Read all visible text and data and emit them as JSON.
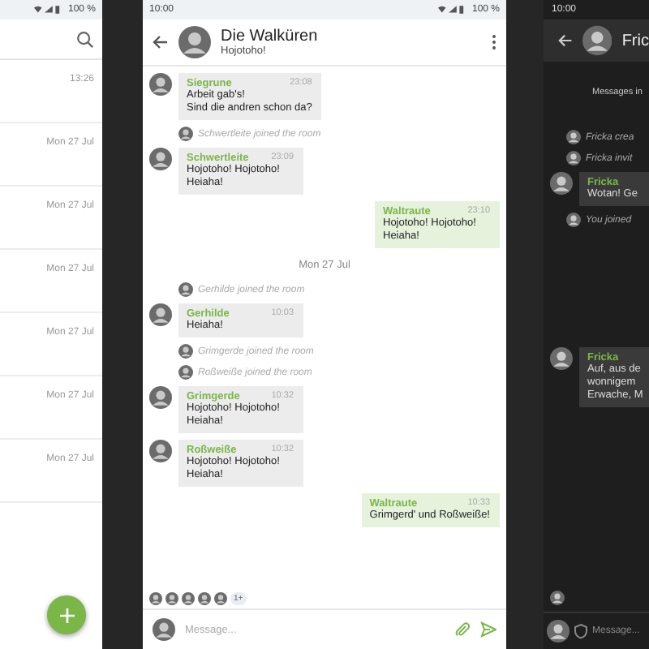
{
  "list_screen": {
    "status_battery": "100 %",
    "rows": [
      {
        "time": "13:26"
      },
      {
        "time": "Mon 27 Jul"
      },
      {
        "time": "Mon 27 Jul"
      },
      {
        "time": "Mon 27 Jul"
      },
      {
        "time": "Mon 27 Jul"
      },
      {
        "time": "Mon 27 Jul"
      },
      {
        "time": "Mon 27 Jul"
      }
    ]
  },
  "chat_screen": {
    "status_time": "10:00",
    "status_battery": "100 %",
    "room_name": "Die Walküren",
    "room_topic": "Hojotoho!",
    "timeline": [
      {
        "kind": "message",
        "sender": "Siegrune",
        "time": "23:08",
        "lines": [
          "Arbeit gab's!",
          "Sind die andren schon da?"
        ]
      },
      {
        "kind": "event",
        "text": "Schwertleite joined the room"
      },
      {
        "kind": "message",
        "sender": "Schwertleite",
        "time": "23:09",
        "lines": [
          "Hojotoho! Hojotoho!",
          "Heiaha!"
        ]
      },
      {
        "kind": "own",
        "sender": "Waltraute",
        "time": "23:10",
        "lines": [
          "Hojotoho! Hojotoho!",
          "Heiaha!"
        ]
      },
      {
        "kind": "date",
        "text": "Mon 27 Jul"
      },
      {
        "kind": "event",
        "text": "Gerhilde joined the room"
      },
      {
        "kind": "message",
        "sender": "Gerhilde",
        "time": "10:03",
        "lines": [
          "Heiaha!"
        ]
      },
      {
        "kind": "event",
        "text": "Grimgerde joined the room"
      },
      {
        "kind": "event",
        "text": "Roßweiße joined the room"
      },
      {
        "kind": "message",
        "sender": "Grimgerde",
        "time": "10:32",
        "lines": [
          "Hojotoho! Hojotoho!",
          "Heiaha!"
        ]
      },
      {
        "kind": "message",
        "sender": "Roßweiße",
        "time": "10:32",
        "lines": [
          "Hojotoho! Hojotoho!",
          "Heiaha!"
        ]
      },
      {
        "kind": "own",
        "sender": "Waltraute",
        "time": "10:33",
        "lines": [
          "Grimgerd' und Roßweiße!"
        ]
      }
    ],
    "read_receipts": {
      "more": "1+"
    },
    "composer": {
      "placeholder": "Message..."
    }
  },
  "dark_chat_screen": {
    "status_time": "10:00",
    "room_name": "Fric",
    "timeline": [
      {
        "kind": "notice",
        "text": "Messages in"
      },
      {
        "kind": "event",
        "text": "Fricka crea"
      },
      {
        "kind": "event",
        "text": "Fricka invit"
      },
      {
        "kind": "message",
        "sender": "Fricka",
        "lines": [
          "Wotan! Ge"
        ]
      },
      {
        "kind": "event",
        "text": "You joined"
      },
      {
        "kind": "message",
        "sender": "Fricka",
        "lines": [
          "Auf, aus de",
          "wonnigem",
          "Erwache, M"
        ]
      }
    ],
    "composer": {
      "placeholder": "Message..."
    }
  }
}
